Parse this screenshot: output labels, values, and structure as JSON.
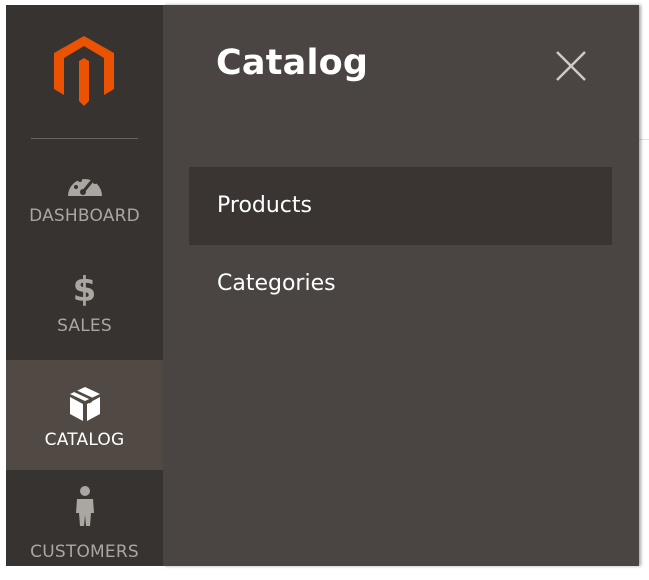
{
  "sidebar": {
    "logo": "magento-logo",
    "items": [
      {
        "label": "DASHBOARD",
        "icon": "speedometer-icon"
      },
      {
        "label": "SALES",
        "icon": "dollar-icon"
      },
      {
        "label": "CATALOG",
        "icon": "box-icon",
        "active": true
      },
      {
        "label": "CUSTOMERS",
        "icon": "person-icon"
      }
    ]
  },
  "flyout": {
    "title": "Catalog",
    "close_icon": "close-icon",
    "items": [
      {
        "label": "Products",
        "active": true
      },
      {
        "label": "Categories"
      }
    ]
  },
  "colors": {
    "sidebar_bg": "#373330",
    "sidebar_active_bg": "#514943",
    "flyout_bg": "#4a4542",
    "flyout_active_item_bg": "#3a3532",
    "logo_orange": "#eb5202"
  }
}
